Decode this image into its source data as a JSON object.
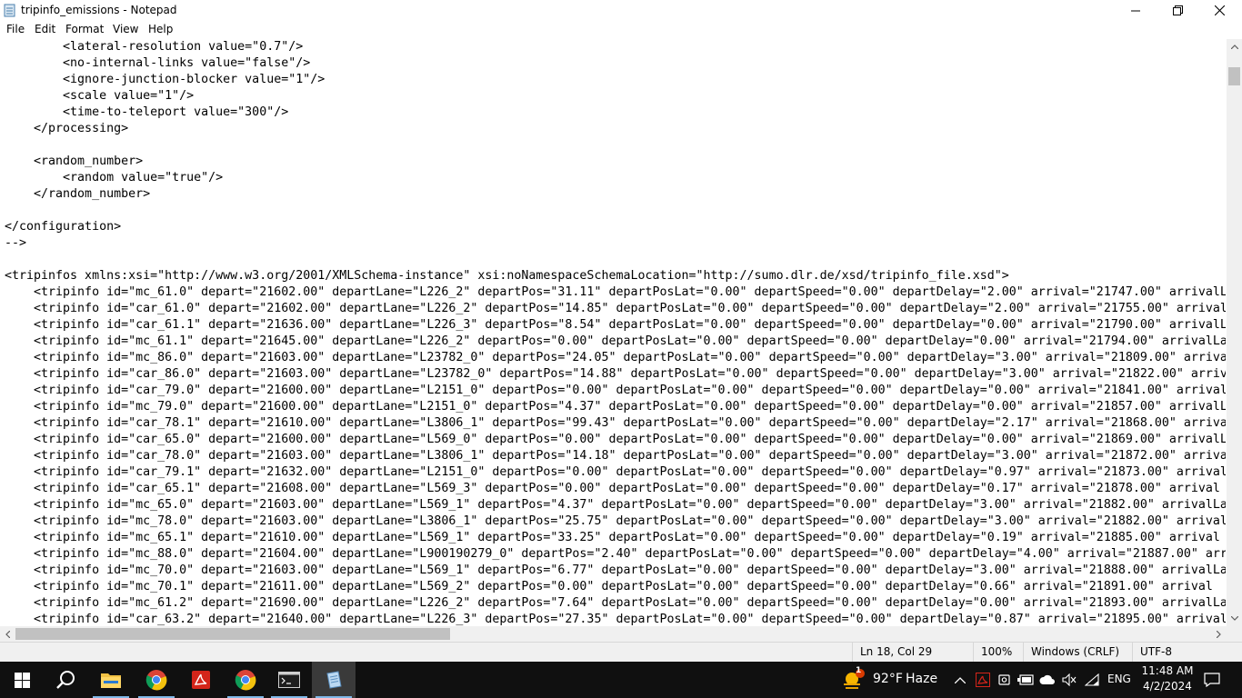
{
  "window": {
    "title": "tripinfo_emissions - Notepad",
    "controls": {
      "minimize": "minimize",
      "maximize": "maximize",
      "close": "close"
    }
  },
  "menu": [
    "File",
    "Edit",
    "Format",
    "View",
    "Help"
  ],
  "editor": {
    "lines": [
      "        <lateral-resolution value=\"0.7\"/>",
      "        <no-internal-links value=\"false\"/>",
      "        <ignore-junction-blocker value=\"1\"/>",
      "        <scale value=\"1\"/>",
      "        <time-to-teleport value=\"300\"/>",
      "    </processing>",
      "",
      "    <random_number>",
      "        <random value=\"true\"/>",
      "    </random_number>",
      "",
      "</configuration>",
      "-->",
      "",
      "<tripinfos xmlns:xsi=\"http://www.w3.org/2001/XMLSchema-instance\" xsi:noNamespaceSchemaLocation=\"http://sumo.dlr.de/xsd/tripinfo_file.xsd\">",
      "    <tripinfo id=\"mc_61.0\" depart=\"21602.00\" departLane=\"L226_2\" departPos=\"31.11\" departPosLat=\"0.00\" departSpeed=\"0.00\" departDelay=\"2.00\" arrival=\"21747.00\" arrivalL",
      "    <tripinfo id=\"car_61.0\" depart=\"21602.00\" departLane=\"L226_2\" departPos=\"14.85\" departPosLat=\"0.00\" departSpeed=\"0.00\" departDelay=\"2.00\" arrival=\"21755.00\" arrival",
      "    <tripinfo id=\"car_61.1\" depart=\"21636.00\" departLane=\"L226_3\" departPos=\"8.54\" departPosLat=\"0.00\" departSpeed=\"0.00\" departDelay=\"0.00\" arrival=\"21790.00\" arrivalL",
      "    <tripinfo id=\"mc_61.1\" depart=\"21645.00\" departLane=\"L226_2\" departPos=\"0.00\" departPosLat=\"0.00\" departSpeed=\"0.00\" departDelay=\"0.00\" arrival=\"21794.00\" arrivalLa",
      "    <tripinfo id=\"mc_86.0\" depart=\"21603.00\" departLane=\"L23782_0\" departPos=\"24.05\" departPosLat=\"0.00\" departSpeed=\"0.00\" departDelay=\"3.00\" arrival=\"21809.00\" arriva",
      "    <tripinfo id=\"car_86.0\" depart=\"21603.00\" departLane=\"L23782_0\" departPos=\"14.88\" departPosLat=\"0.00\" departSpeed=\"0.00\" departDelay=\"3.00\" arrival=\"21822.00\" arriv",
      "    <tripinfo id=\"car_79.0\" depart=\"21600.00\" departLane=\"L2151_0\" departPos=\"0.00\" departPosLat=\"0.00\" departSpeed=\"0.00\" departDelay=\"0.00\" arrival=\"21841.00\" arrival",
      "    <tripinfo id=\"mc_79.0\" depart=\"21600.00\" departLane=\"L2151_0\" departPos=\"4.37\" departPosLat=\"0.00\" departSpeed=\"0.00\" departDelay=\"0.00\" arrival=\"21857.00\" arrivalL",
      "    <tripinfo id=\"car_78.1\" depart=\"21610.00\" departLane=\"L3806_1\" departPos=\"99.43\" departPosLat=\"0.00\" departSpeed=\"0.00\" departDelay=\"2.17\" arrival=\"21868.00\" arriva",
      "    <tripinfo id=\"car_65.0\" depart=\"21600.00\" departLane=\"L569_0\" departPos=\"0.00\" departPosLat=\"0.00\" departSpeed=\"0.00\" departDelay=\"0.00\" arrival=\"21869.00\" arrivalL",
      "    <tripinfo id=\"car_78.0\" depart=\"21603.00\" departLane=\"L3806_1\" departPos=\"14.18\" departPosLat=\"0.00\" departSpeed=\"0.00\" departDelay=\"3.00\" arrival=\"21872.00\" arriva",
      "    <tripinfo id=\"car_79.1\" depart=\"21632.00\" departLane=\"L2151_0\" departPos=\"0.00\" departPosLat=\"0.00\" departSpeed=\"0.00\" departDelay=\"0.97\" arrival=\"21873.00\" arrival",
      "    <tripinfo id=\"car_65.1\" depart=\"21608.00\" departLane=\"L569_3\" departPos=\"0.00\" departPosLat=\"0.00\" departSpeed=\"0.00\" departDelay=\"0.17\" arrival=\"21878.00\" arrival",
      "    <tripinfo id=\"mc_65.0\" depart=\"21603.00\" departLane=\"L569_1\" departPos=\"4.37\" departPosLat=\"0.00\" departSpeed=\"0.00\" departDelay=\"3.00\" arrival=\"21882.00\" arrivalLa",
      "    <tripinfo id=\"mc_78.0\" depart=\"21603.00\" departLane=\"L3806_1\" departPos=\"25.75\" departPosLat=\"0.00\" departSpeed=\"0.00\" departDelay=\"3.00\" arrival=\"21882.00\" arrival",
      "    <tripinfo id=\"mc_65.1\" depart=\"21610.00\" departLane=\"L569_1\" departPos=\"33.25\" departPosLat=\"0.00\" departSpeed=\"0.00\" departDelay=\"0.19\" arrival=\"21885.00\" arrival",
      "    <tripinfo id=\"mc_88.0\" depart=\"21604.00\" departLane=\"L900190279_0\" departPos=\"2.40\" departPosLat=\"0.00\" departSpeed=\"0.00\" departDelay=\"4.00\" arrival=\"21887.00\" arr",
      "    <tripinfo id=\"mc_70.0\" depart=\"21603.00\" departLane=\"L569_1\" departPos=\"6.77\" departPosLat=\"0.00\" departSpeed=\"0.00\" departDelay=\"3.00\" arrival=\"21888.00\" arrivalLa",
      "    <tripinfo id=\"mc_70.1\" depart=\"21611.00\" departLane=\"L569_2\" departPos=\"0.00\" departPosLat=\"0.00\" departSpeed=\"0.00\" departDelay=\"0.66\" arrival=\"21891.00\" arrival",
      "    <tripinfo id=\"mc_61.2\" depart=\"21690.00\" departLane=\"L226_2\" departPos=\"7.64\" departPosLat=\"0.00\" departSpeed=\"0.00\" departDelay=\"0.00\" arrival=\"21893.00\" arrivalLa",
      "    <tripinfo id=\"car_63.2\" depart=\"21640.00\" departLane=\"L226_3\" departPos=\"27.35\" departPosLat=\"0.00\" departSpeed=\"0.00\" departDelay=\"0.87\" arrival=\"21895.00\" arrival"
    ]
  },
  "status": {
    "position": "Ln 18, Col 29",
    "zoom": "100%",
    "line_ending": "Windows (CRLF)",
    "encoding": "UTF-8"
  },
  "taskbar": {
    "apps": [
      "start-icon",
      "search-icon",
      "file-explorer-icon",
      "chrome-icon",
      "acrobat-icon",
      "chrome-icon",
      "terminal-icon",
      "notepad-icon"
    ],
    "weather": {
      "temp": "92°F",
      "condition": "Haze",
      "alert_badge": "1"
    },
    "language": "ENG",
    "time": "11:48 AM",
    "date": "4/2/2024"
  },
  "colors": {
    "taskbar_bg": "#101010",
    "scrollbar_thumb": "#c1c1c1",
    "statusbar_bg": "#f0f0f0"
  }
}
